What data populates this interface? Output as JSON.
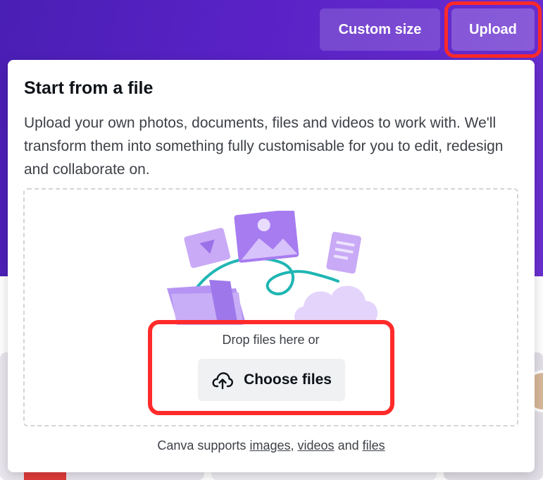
{
  "header": {
    "custom_size_label": "Custom size",
    "upload_label": "Upload"
  },
  "upload_panel": {
    "title": "Start from a file",
    "description": "Upload your own photos, documents, files and videos to work with. We'll transform them into something fully customisable for you to edit, redesign and collaborate on.",
    "drop_text": "Drop files here or",
    "choose_files_label": "Choose files",
    "support_prefix": "Canva supports",
    "support_links": [
      "images",
      "videos",
      "files"
    ],
    "support_sep": ",",
    "support_and": "and"
  },
  "colors": {
    "brand_purple": "#5a22c6",
    "highlight_red": "#ff2a2a",
    "illustration_lilac": "#b38cf2",
    "illustration_teal": "#1fb6b3"
  },
  "icons": {
    "choose_files": "cloud-upload-icon"
  }
}
